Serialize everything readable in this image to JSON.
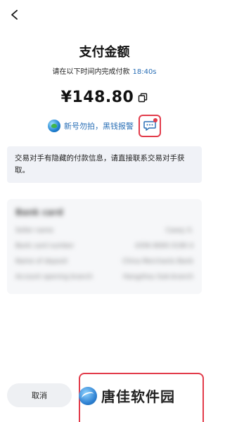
{
  "header": {
    "back_icon": "chevron-left-icon"
  },
  "payment": {
    "title": "支付金额",
    "deadline_label": "请在以下时间内完成付款",
    "deadline_time": "18:40s",
    "amount": "¥148.80",
    "copy_icon": "copy-icon"
  },
  "warning": {
    "text": "新号勿拍，黑钱报警",
    "chat_icon": "chat-bubble-icon"
  },
  "notice": {
    "text": "交易对手有隐藏的付款信息，请直接联系交易对手获取。"
  },
  "blurred_details": {
    "title": "Bank card",
    "rows": [
      {
        "label": "Seller name",
        "value": "Casey X."
      },
      {
        "label": "Bank card number",
        "value": "4356 8000 0190 4"
      },
      {
        "label": "Name of deposit",
        "value": "China Merchants Bank"
      },
      {
        "label": "Account opening branch",
        "value": "Hangzhou Sub-branch"
      }
    ]
  },
  "footer": {
    "cancel_label": "取消",
    "watermark_text": "唐佳软件园"
  },
  "colors": {
    "accent_blue": "#2a6fb6",
    "highlight_red": "#e23b4a",
    "notice_bg": "#f0f2f7"
  }
}
